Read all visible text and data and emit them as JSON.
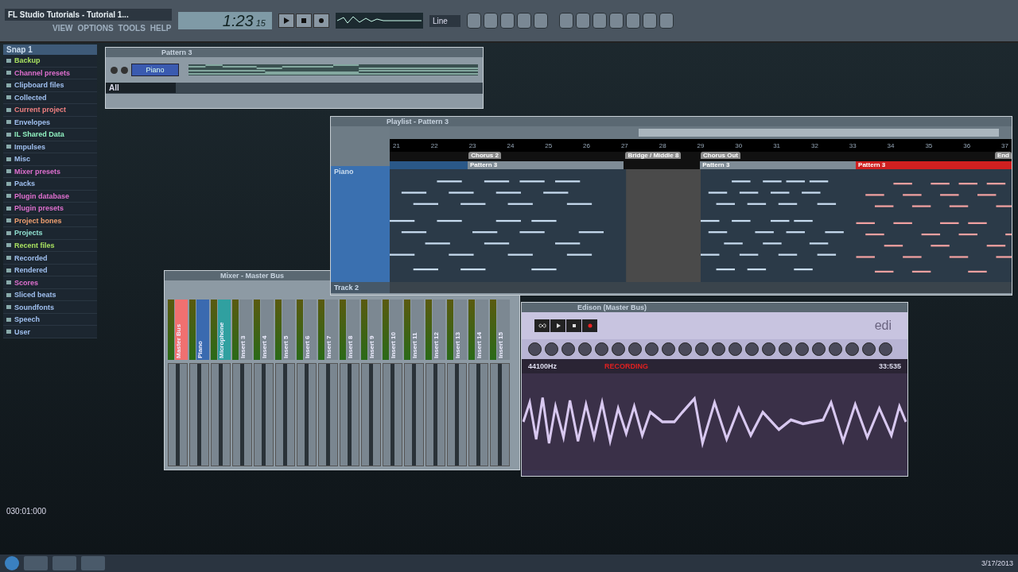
{
  "top_bar": {
    "title": "FL Studio Tutorials - Tutorial 1...",
    "menu": [
      "VIEW",
      "OPTIONS",
      "TOOLS",
      "HELP"
    ],
    "time_main": "1:23",
    "time_small": "15",
    "preset": "Line"
  },
  "browser": {
    "title": "Snap 1",
    "items": [
      {
        "label": "Backup",
        "color": "#a8e060"
      },
      {
        "label": "Channel presets",
        "color": "#e070d0"
      },
      {
        "label": "Clipboard files",
        "color": "#a0c0f0"
      },
      {
        "label": "Collected",
        "color": "#a0c0f0"
      },
      {
        "label": "Current project",
        "color": "#f08080"
      },
      {
        "label": "Envelopes",
        "color": "#a0c0f0"
      },
      {
        "label": "IL Shared Data",
        "color": "#90f0c0"
      },
      {
        "label": "Impulses",
        "color": "#a0c0f0"
      },
      {
        "label": "Misc",
        "color": "#a0c0f0"
      },
      {
        "label": "Mixer presets",
        "color": "#e070d0"
      },
      {
        "label": "Packs",
        "color": "#a0c0f0"
      },
      {
        "label": "Plugin database",
        "color": "#e070d0"
      },
      {
        "label": "Plugin presets",
        "color": "#e070d0"
      },
      {
        "label": "Project bones",
        "color": "#f0a070"
      },
      {
        "label": "Projects",
        "color": "#90e0d0"
      },
      {
        "label": "Recent files",
        "color": "#a8e060"
      },
      {
        "label": "Recorded",
        "color": "#a0c0f0"
      },
      {
        "label": "Rendered",
        "color": "#a0c0f0"
      },
      {
        "label": "Scores",
        "color": "#e070d0"
      },
      {
        "label": "Sliced beats",
        "color": "#a0c0f0"
      },
      {
        "label": "Soundfonts",
        "color": "#a0c0f0"
      },
      {
        "label": "Speech",
        "color": "#a0c0f0"
      },
      {
        "label": "User",
        "color": "#a0c0f0"
      }
    ]
  },
  "step_sequencer": {
    "title": "Pattern 3",
    "channel": "Piano",
    "filter": "All"
  },
  "playlist": {
    "title": "Playlist - Pattern 3",
    "tracks": [
      "Piano",
      "Track 2"
    ],
    "ruler": [
      "21",
      "22",
      "23",
      "24",
      "25",
      "26",
      "27",
      "28",
      "29",
      "30",
      "31",
      "32",
      "33",
      "34",
      "35",
      "36",
      "37"
    ],
    "markers": [
      "Chorus 2",
      "Bridge / Middle 8",
      "Chorus Out",
      "End"
    ],
    "clips": [
      {
        "label": "Pattern 3",
        "selected": false
      },
      {
        "label": "Pattern 3",
        "selected": false
      },
      {
        "label": "Pattern 3",
        "selected": true
      }
    ]
  },
  "mixer": {
    "title": "Mixer - Master Bus",
    "tracks": [
      {
        "name": "Master Bus",
        "color": "#f07070"
      },
      {
        "name": "Piano",
        "color": "#3a6ab0"
      },
      {
        "name": "Microphone",
        "color": "#30a0a0"
      },
      {
        "name": "Insert 3",
        "color": "#7c8892"
      },
      {
        "name": "Insert 4",
        "color": "#7c8892"
      },
      {
        "name": "Insert 5",
        "color": "#7c8892"
      },
      {
        "name": "Insert 6",
        "color": "#7c8892"
      },
      {
        "name": "Insert 7",
        "color": "#7c8892"
      },
      {
        "name": "Insert 8",
        "color": "#7c8892"
      },
      {
        "name": "Insert 9",
        "color": "#7c8892"
      },
      {
        "name": "Insert 10",
        "color": "#7c8892"
      },
      {
        "name": "Insert 11",
        "color": "#7c8892"
      },
      {
        "name": "Insert 12",
        "color": "#7c8892"
      },
      {
        "name": "Insert 13",
        "color": "#7c8892"
      },
      {
        "name": "Insert 14",
        "color": "#7c8892"
      },
      {
        "name": "Insert 15",
        "color": "#7c8892"
      }
    ]
  },
  "edison": {
    "title": "Edison (Master Bus)",
    "logo": "edi",
    "sample_rate": "44100Hz",
    "status": "RECORDING",
    "length": "33:535"
  },
  "hint_time": "030:01:000",
  "taskbar": {
    "date": "3/17/2013"
  }
}
